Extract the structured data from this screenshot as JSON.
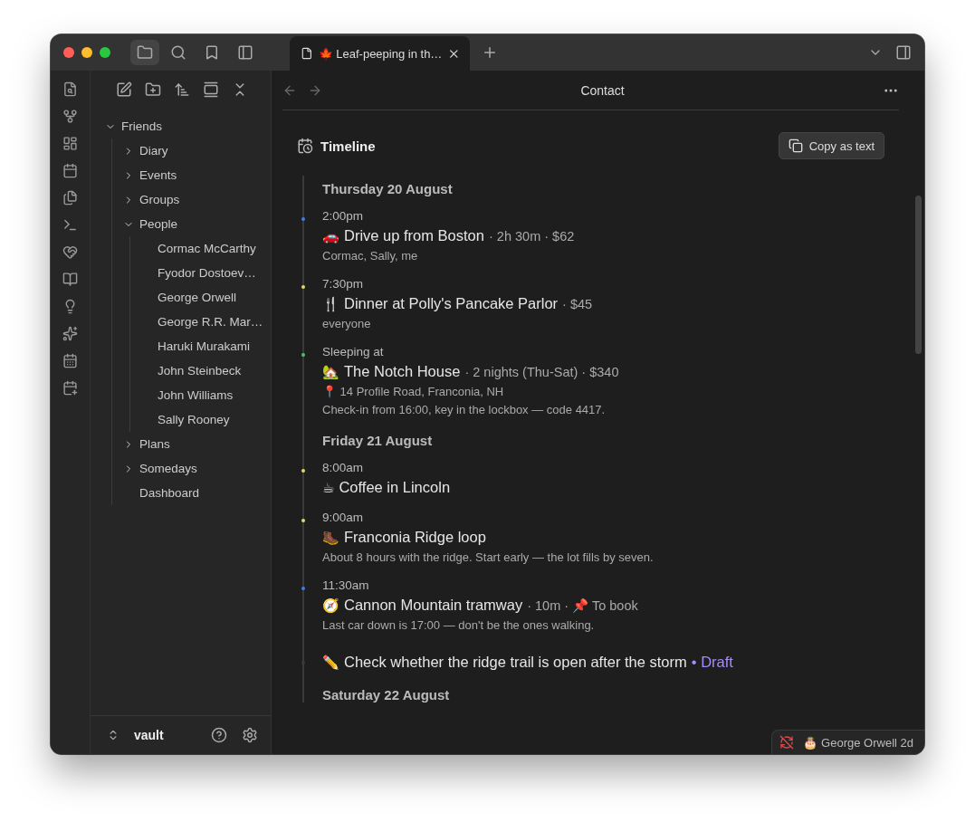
{
  "window": {
    "tabs": [
      {
        "emoji": "🍁",
        "title": "Leaf-peeping in th…",
        "selected": true
      }
    ]
  },
  "sidebar": {
    "items": [
      {
        "kind": "folder",
        "label": "Friends",
        "expanded": true,
        "children": [
          {
            "kind": "folder",
            "label": "Diary",
            "expanded": false
          },
          {
            "kind": "folder",
            "label": "Events",
            "expanded": false
          },
          {
            "kind": "folder",
            "label": "Groups",
            "expanded": false
          },
          {
            "kind": "folder",
            "label": "People",
            "expanded": true,
            "children": [
              {
                "kind": "file",
                "label": "Cormac McCarthy"
              },
              {
                "kind": "file",
                "label": "Fyodor Dostoev…"
              },
              {
                "kind": "file",
                "label": "George Orwell"
              },
              {
                "kind": "file",
                "label": "George R.R. Mar…"
              },
              {
                "kind": "file",
                "label": "Haruki Murakami"
              },
              {
                "kind": "file",
                "label": "John Steinbeck"
              },
              {
                "kind": "file",
                "label": "John Williams"
              },
              {
                "kind": "file",
                "label": "Sally Rooney"
              }
            ]
          },
          {
            "kind": "folder",
            "label": "Plans",
            "expanded": false
          },
          {
            "kind": "folder",
            "label": "Somedays",
            "expanded": false
          },
          {
            "kind": "file",
            "label": "Dashboard"
          }
        ]
      }
    ],
    "vault": "vault"
  },
  "view": {
    "title": "Contact",
    "section_title": "Timeline",
    "copy_button": "Copy as text",
    "days": [
      {
        "date": "Thursday 20 August",
        "entries": [
          {
            "kind": "event",
            "color": "#3b7cf0",
            "time": "2:00pm",
            "emoji": "🚗",
            "title": "Drive up from Boston",
            "meta": "· 2h 30m · $62",
            "lines": [
              "Cormac, Sally, me"
            ]
          },
          {
            "kind": "event",
            "color": "#e3d766",
            "time": "7:30pm",
            "emoji": "🍴",
            "title": "Dinner at Polly's Pancake Parlor",
            "meta": "· $45",
            "lines": [
              "everyone"
            ]
          },
          {
            "kind": "event",
            "color": "#4cc26a",
            "time": "Sleeping at",
            "emoji": "🏡",
            "title": "The Notch House",
            "meta": "· 2 nights (Thu-Sat) · $340",
            "lines": [
              "📍 14 Profile Road, Franconia, NH",
              "Check-in from 16:00, key in the lockbox — code 4417."
            ]
          }
        ]
      },
      {
        "date": "Friday 21 August",
        "entries": [
          {
            "kind": "event",
            "color": "#e3d766",
            "time": "8:00am",
            "emoji": "☕",
            "title": "Coffee in Lincoln"
          },
          {
            "kind": "event",
            "color": "#e3d766",
            "time": "9:00am",
            "emoji": "🥾",
            "title": "Franconia Ridge loop",
            "lines": [
              "About 8 hours with the ridge. Start early — the lot fills by seven."
            ]
          },
          {
            "kind": "event",
            "color": "#3b7cf0",
            "time": "11:30am",
            "emoji": "🧭",
            "title": "Cannon Mountain tramway",
            "meta": "· 10m · 📌 To book",
            "lines": [
              "Last car down is 17:00 — don't be the ones walking."
            ]
          },
          {
            "kind": "task",
            "color": "#3a3a3a",
            "emoji": "✏️",
            "title": "Check whether the ridge trail is open after the storm",
            "status": "• Draft"
          }
        ]
      },
      {
        "date": "Saturday 22 August"
      }
    ]
  },
  "status_bar": {
    "emoji": "🎂",
    "text": "George Orwell 2d",
    "sync_off": true
  }
}
